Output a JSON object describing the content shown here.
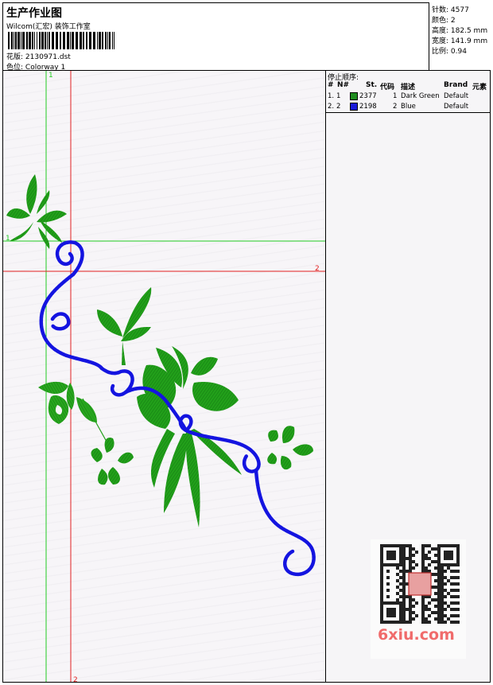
{
  "header": {
    "title": "生产作业图",
    "software": "Wilcom(汇宏) 装饰工作室",
    "design_label": "花版:",
    "design_value": "2130971.dst",
    "colorway_label": "色位:",
    "colorway_value": "Colorway 1"
  },
  "stats": {
    "stitches_label": "针数:",
    "stitches": "4577",
    "colors_label": "颜色:",
    "colors": "2",
    "height_label": "高度:",
    "height": "182.5 mm",
    "width_label": "宽度:",
    "width": "141.9 mm",
    "ratio_label": "比例:",
    "ratio": "0.94"
  },
  "stop_sequence": {
    "title": "停止顺序:",
    "columns": [
      "#",
      "N#",
      "St.",
      "代码",
      "描述",
      "Brand",
      "元素"
    ],
    "rows": [
      {
        "index": "1.",
        "needle": "1",
        "stitch_code": "2377",
        "code": "1",
        "description": "Dark Green",
        "brand": "Default",
        "color": "#1e8c1e"
      },
      {
        "index": "2.",
        "needle": "2",
        "stitch_code": "2198",
        "code": "2",
        "description": "Blue",
        "brand": "Default",
        "color": "#1a1ad8"
      }
    ]
  },
  "guides": {
    "green_label_top": "1",
    "green_label_left": "1",
    "red_label_right": "2",
    "red_label_bottom": "2"
  },
  "watermark": {
    "text": "6xiu.com"
  },
  "colors": {
    "green_thread": "#22a01a",
    "blue_thread": "#1414e0",
    "green_guide": "#22cc22",
    "red_guide": "#e02020"
  }
}
